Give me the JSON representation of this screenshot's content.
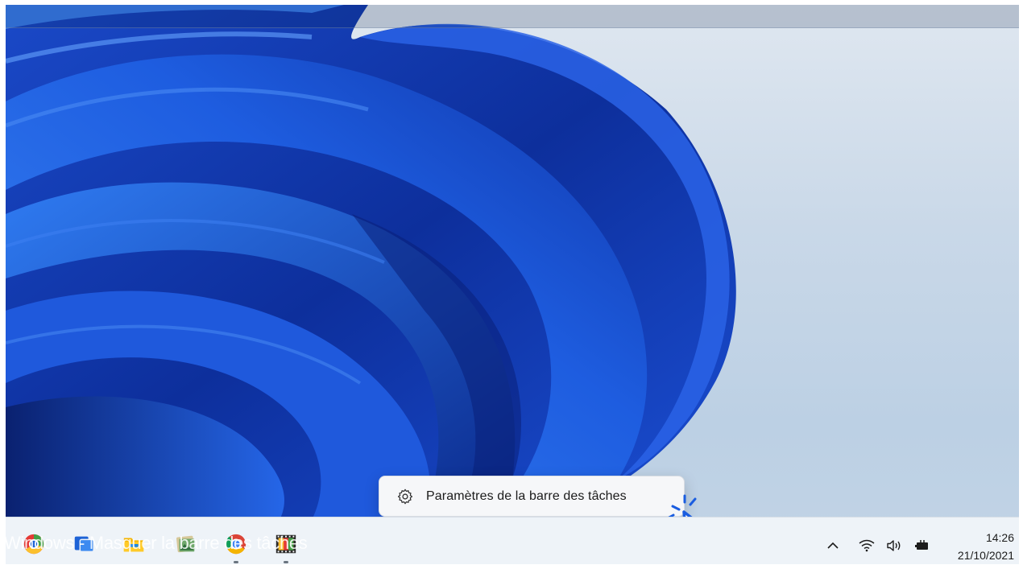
{
  "desktop": {
    "context_menu": {
      "icon": "gear-icon",
      "label": "Paramètres de la barre des tâches"
    }
  },
  "taskbar": {
    "apps": [
      {
        "name": "windows-start-icon",
        "running": false
      },
      {
        "name": "task-view-icon",
        "running": false
      },
      {
        "name": "file-explorer-icon",
        "running": false
      },
      {
        "name": "photos-icon",
        "running": false
      },
      {
        "name": "chrome-icon",
        "running": true
      },
      {
        "name": "video-editor-icon",
        "running": true
      }
    ],
    "overlay_text": "Windows - Masquer la barre des tâches",
    "tray": {
      "icons": [
        "chevron-up-icon",
        "wifi-icon",
        "volume-icon",
        "battery-icon"
      ]
    },
    "clock": {
      "time": "14:26",
      "date": "21/10/2021"
    }
  },
  "colors": {
    "accent": "#1a5de0",
    "wallpaper_background": "#c9d8e8",
    "taskbar": "#eef3f8"
  }
}
